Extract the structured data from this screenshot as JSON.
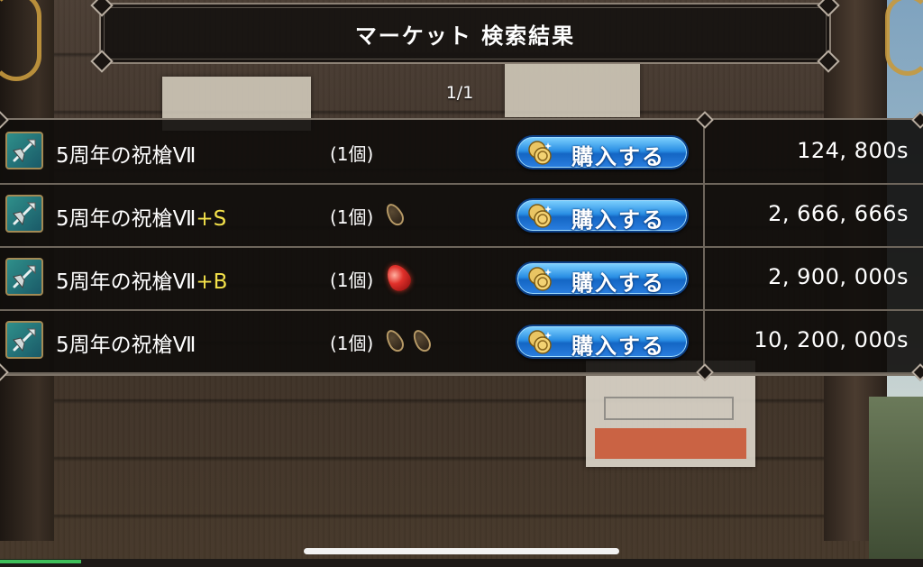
{
  "header": {
    "title": "マーケット 検索結果"
  },
  "pagination": {
    "label": "1/1"
  },
  "results": [
    {
      "name": "5周年の祝槍Ⅶ",
      "suffix": "",
      "quantity": "(1個)",
      "extras": [],
      "buy_label": "購入する",
      "price": "124, 800s"
    },
    {
      "name": "5周年の祝槍Ⅶ",
      "suffix": "+S",
      "quantity": "(1個)",
      "extras": [
        "seed-icon"
      ],
      "buy_label": "購入する",
      "price": "2, 666, 666s"
    },
    {
      "name": "5周年の祝槍Ⅶ",
      "suffix": "+B",
      "quantity": "(1個)",
      "extras": [
        "red-gem-icon"
      ],
      "buy_label": "購入する",
      "price": "2, 900, 000s"
    },
    {
      "name": "5周年の祝槍Ⅶ",
      "suffix": "",
      "quantity": "(1個)",
      "extras": [
        "seed-icon",
        "seed-icon"
      ],
      "buy_label": "購入する",
      "price": "10, 200, 000s"
    }
  ],
  "colors": {
    "suffix": "#f4e24a",
    "buy_button": "#2a8fe4",
    "panel": "#100d0b"
  }
}
